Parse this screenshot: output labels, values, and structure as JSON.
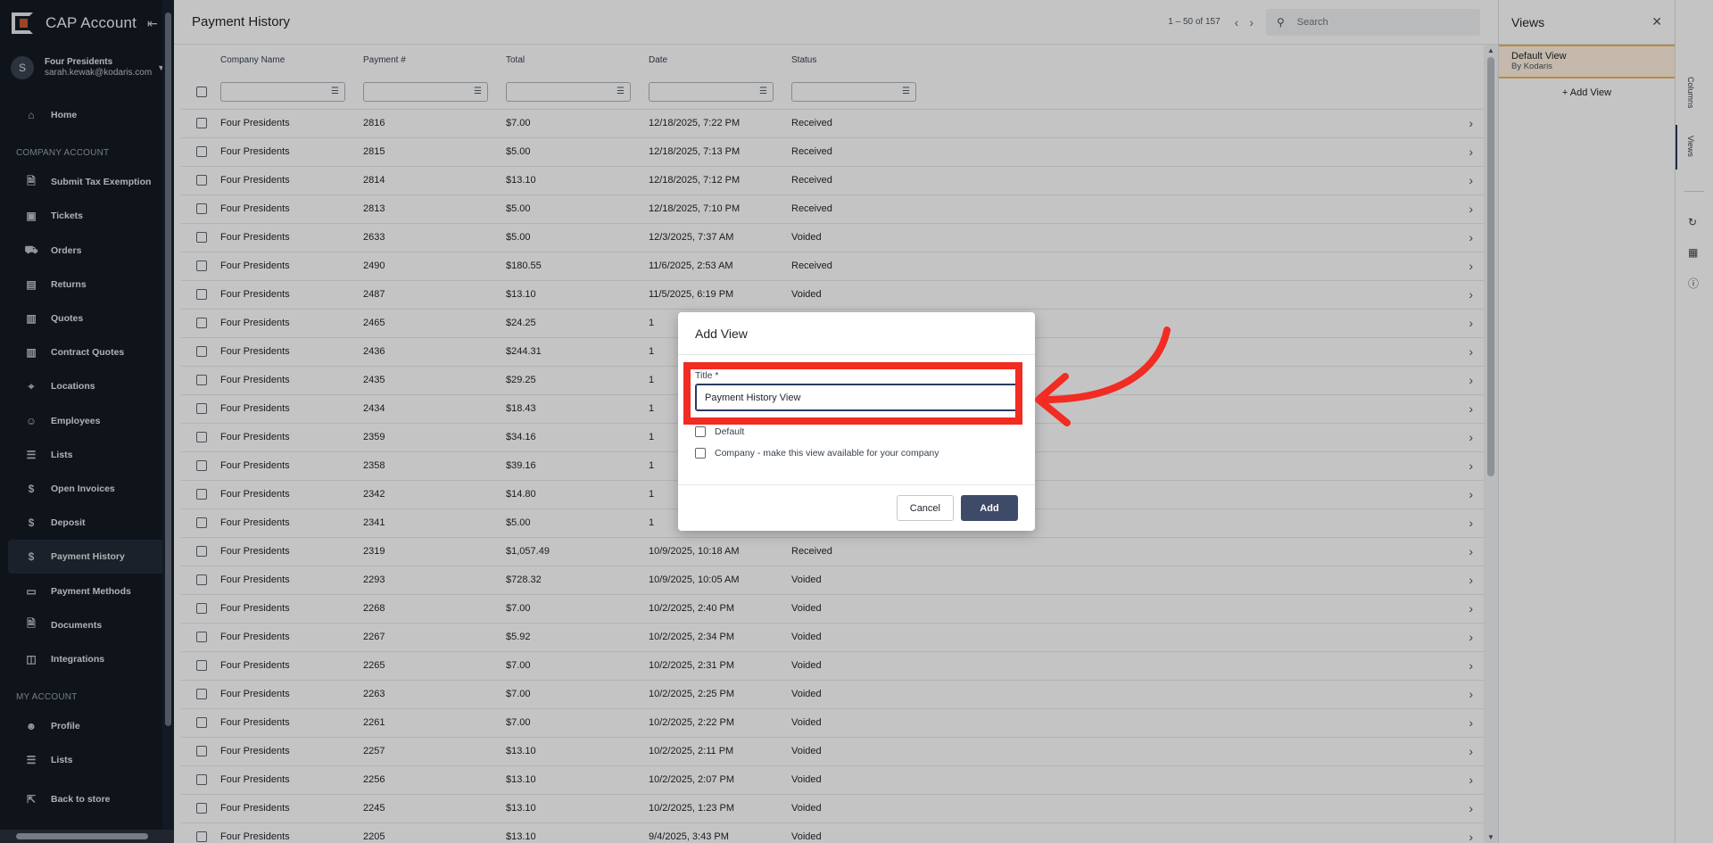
{
  "sidebar": {
    "app_title": "CAP Account",
    "user": {
      "initial": "S",
      "name": "Four Presidents",
      "email": "sarah.kewak@kodaris.com"
    },
    "home_label": "Home",
    "company_section": "COMPANY ACCOUNT",
    "company_items": [
      {
        "label": "Submit Tax Exemption",
        "icon": "document-icon"
      },
      {
        "label": "Tickets",
        "icon": "ticket-icon"
      },
      {
        "label": "Orders",
        "icon": "truck-icon"
      },
      {
        "label": "Returns",
        "icon": "return-box-icon"
      },
      {
        "label": "Quotes",
        "icon": "clipboard-icon"
      },
      {
        "label": "Contract Quotes",
        "icon": "clipboard-icon"
      },
      {
        "label": "Locations",
        "icon": "map-pin-icon"
      },
      {
        "label": "Employees",
        "icon": "people-icon"
      },
      {
        "label": "Lists",
        "icon": "list-icon"
      },
      {
        "label": "Open Invoices",
        "icon": "dollar-icon"
      },
      {
        "label": "Deposit",
        "icon": "dollar-icon"
      },
      {
        "label": "Payment History",
        "icon": "dollar-icon",
        "active": true
      },
      {
        "label": "Payment Methods",
        "icon": "credit-card-icon"
      },
      {
        "label": "Documents",
        "icon": "document-icon"
      },
      {
        "label": "Integrations",
        "icon": "integration-icon"
      }
    ],
    "my_section": "MY ACCOUNT",
    "my_items": [
      {
        "label": "Profile",
        "icon": "person-icon"
      },
      {
        "label": "Lists",
        "icon": "list-icon"
      }
    ],
    "back_label": "Back to store"
  },
  "header": {
    "title": "Payment History",
    "pager_text": "1 – 50 of 157",
    "search_placeholder": "Search"
  },
  "table": {
    "columns": [
      "Company Name",
      "Payment #",
      "Total",
      "Date",
      "Status"
    ],
    "rows": [
      [
        "Four Presidents",
        "2816",
        "$7.00",
        "12/18/2025, 7:22 PM",
        "Received"
      ],
      [
        "Four Presidents",
        "2815",
        "$5.00",
        "12/18/2025, 7:13 PM",
        "Received"
      ],
      [
        "Four Presidents",
        "2814",
        "$13.10",
        "12/18/2025, 7:12 PM",
        "Received"
      ],
      [
        "Four Presidents",
        "2813",
        "$5.00",
        "12/18/2025, 7:10 PM",
        "Received"
      ],
      [
        "Four Presidents",
        "2633",
        "$5.00",
        "12/3/2025, 7:37 AM",
        "Voided"
      ],
      [
        "Four Presidents",
        "2490",
        "$180.55",
        "11/6/2025, 2:53 AM",
        "Received"
      ],
      [
        "Four Presidents",
        "2487",
        "$13.10",
        "11/5/2025, 6:19 PM",
        "Voided"
      ],
      [
        "Four Presidents",
        "2465",
        "$24.25",
        "1",
        ""
      ],
      [
        "Four Presidents",
        "2436",
        "$244.31",
        "1",
        ""
      ],
      [
        "Four Presidents",
        "2435",
        "$29.25",
        "1",
        ""
      ],
      [
        "Four Presidents",
        "2434",
        "$18.43",
        "1",
        ""
      ],
      [
        "Four Presidents",
        "2359",
        "$34.16",
        "1",
        ""
      ],
      [
        "Four Presidents",
        "2358",
        "$39.16",
        "1",
        ""
      ],
      [
        "Four Presidents",
        "2342",
        "$14.80",
        "1",
        ""
      ],
      [
        "Four Presidents",
        "2341",
        "$5.00",
        "1",
        ""
      ],
      [
        "Four Presidents",
        "2319",
        "$1,057.49",
        "10/9/2025, 10:18 AM",
        "Received"
      ],
      [
        "Four Presidents",
        "2293",
        "$728.32",
        "10/9/2025, 10:05 AM",
        "Voided"
      ],
      [
        "Four Presidents",
        "2268",
        "$7.00",
        "10/2/2025, 2:40 PM",
        "Voided"
      ],
      [
        "Four Presidents",
        "2267",
        "$5.92",
        "10/2/2025, 2:34 PM",
        "Voided"
      ],
      [
        "Four Presidents",
        "2265",
        "$7.00",
        "10/2/2025, 2:31 PM",
        "Voided"
      ],
      [
        "Four Presidents",
        "2263",
        "$7.00",
        "10/2/2025, 2:25 PM",
        "Voided"
      ],
      [
        "Four Presidents",
        "2261",
        "$7.00",
        "10/2/2025, 2:22 PM",
        "Voided"
      ],
      [
        "Four Presidents",
        "2257",
        "$13.10",
        "10/2/2025, 2:11 PM",
        "Voided"
      ],
      [
        "Four Presidents",
        "2256",
        "$13.10",
        "10/2/2025, 2:07 PM",
        "Voided"
      ],
      [
        "Four Presidents",
        "2245",
        "$13.10",
        "10/2/2025, 1:23 PM",
        "Voided"
      ],
      [
        "Four Presidents",
        "2205",
        "$13.10",
        "9/4/2025, 3:43 PM",
        "Voided"
      ]
    ]
  },
  "views_panel": {
    "title": "Views",
    "default_view": "Default View",
    "default_by": "By Kodaris",
    "add_label": "+ Add View"
  },
  "side_tabs": {
    "columns": "Columns",
    "views": "Views"
  },
  "dialog": {
    "title": "Add View",
    "title_label": "Title *",
    "title_value": "Payment History View",
    "default_label": "Default",
    "company_label": "Company - make this view available for your company",
    "cancel_label": "Cancel",
    "add_label": "Add"
  },
  "colors": {
    "sidebar_bg": "#141a24",
    "primary_button": "#3d4a68",
    "highlight_annotation": "#f22b23",
    "views_selected_bg": "#fff1de",
    "views_selected_border": "#efb45c"
  }
}
